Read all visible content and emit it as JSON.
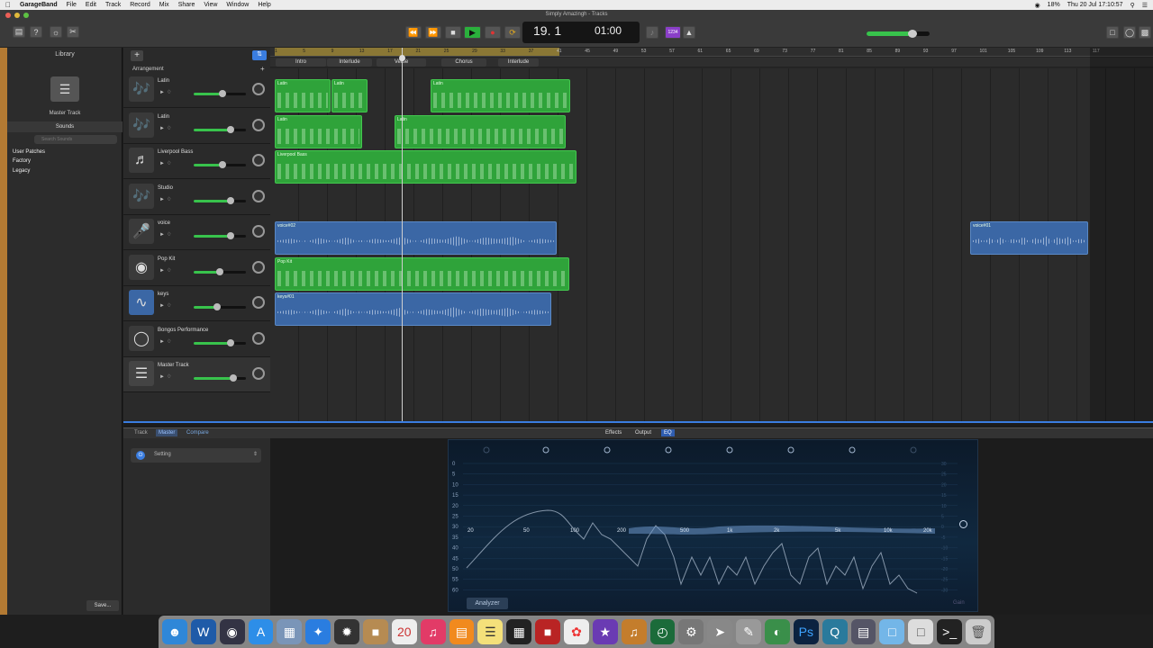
{
  "menubar": {
    "app": "GarageBand",
    "items": [
      "File",
      "Edit",
      "Track",
      "Record",
      "Mix",
      "Share",
      "View",
      "Window",
      "Help"
    ],
    "battery": "18%",
    "clock": "Thu 20 Jul  17:10:57"
  },
  "window": {
    "title": "Simply Amazingh - Tracks"
  },
  "lcd": {
    "bar_beat": "19. 1",
    "time": "01:00",
    "count_in": "1234"
  },
  "library": {
    "title": "Library",
    "preset_name": "Master Track",
    "sounds_label": "Sounds",
    "search_placeholder": "Search Sounds",
    "categories": [
      "User Patches",
      "Factory",
      "Legacy"
    ],
    "save_label": "Save..."
  },
  "tracks_header": {
    "arrangement_label": "Arrangement",
    "add": "+"
  },
  "ruler": {
    "bars": [
      "1",
      "5",
      "9",
      "13",
      "17",
      "21",
      "25",
      "29",
      "33",
      "37",
      "41",
      "45",
      "49",
      "53",
      "57",
      "61",
      "65",
      "69",
      "73",
      "77",
      "81",
      "85",
      "89",
      "93",
      "97",
      "101",
      "105",
      "109",
      "113",
      "117"
    ]
  },
  "arrangement_markers": [
    "Intro",
    "Interlude",
    "Verse",
    "Chorus",
    "Interlude"
  ],
  "tracks": [
    {
      "name": "Latin",
      "icon": "latin-percussion-icon",
      "volume": 0.55
    },
    {
      "name": "Latin",
      "icon": "latin-percussion-icon",
      "volume": 0.7
    },
    {
      "name": "Liverpool Bass",
      "icon": "bass-guitar-icon",
      "volume": 0.55
    },
    {
      "name": "Studio",
      "icon": "latin-percussion-icon",
      "volume": 0.7
    },
    {
      "name": "voice",
      "icon": "microphone-icon",
      "volume": 0.7
    },
    {
      "name": "Pop Kit",
      "icon": "drum-kit-icon",
      "volume": 0.5
    },
    {
      "name": "keys",
      "icon": "waveform-icon",
      "volume": 0.45
    },
    {
      "name": "Bongos Performance",
      "icon": "bongos-icon",
      "volume": 0.7
    },
    {
      "name": "Master Track",
      "icon": "master-track-icon",
      "volume": 0.75
    }
  ],
  "regions": [
    {
      "track": 0,
      "label": "Latin",
      "type": "midi"
    },
    {
      "track": 0,
      "label": "Latin",
      "type": "midi"
    },
    {
      "track": 0,
      "label": "Latin",
      "type": "midi"
    },
    {
      "track": 1,
      "label": "Latin",
      "type": "midi"
    },
    {
      "track": 1,
      "label": "Latin",
      "type": "midi"
    },
    {
      "track": 2,
      "label": "Liverpool Bass",
      "type": "midi"
    },
    {
      "track": 4,
      "label": "voice#02",
      "type": "audio"
    },
    {
      "track": 4,
      "label": "voice#01",
      "type": "audio"
    },
    {
      "track": 5,
      "label": "Pop Kit",
      "type": "midi"
    },
    {
      "track": 6,
      "label": "keys#01",
      "type": "audio"
    }
  ],
  "editor": {
    "tabs_left": [
      "Track",
      "Master",
      "Compare"
    ],
    "tabs_center": [
      "Effects",
      "Output",
      "EQ"
    ],
    "setting_label": "Setting",
    "analyzer_label": "Analyzer",
    "gain_label": "Gain",
    "db_left": [
      "0",
      "5",
      "10",
      "15",
      "20",
      "25",
      "30",
      "35",
      "40",
      "45",
      "50",
      "55",
      "60"
    ],
    "db_right": [
      "30",
      "25",
      "20",
      "15",
      "10",
      "5",
      "0",
      "-5",
      "-10",
      "-15",
      "-20",
      "-25",
      "-30"
    ],
    "freq_labels": [
      "20",
      "50",
      "100",
      "200",
      "500",
      "1k",
      "2k",
      "5k",
      "10k",
      "20k"
    ]
  },
  "colors": {
    "midi_region": "#2fa33a",
    "audio_region": "#3b67a5",
    "accent": "#3a7de0",
    "play": "#2ab03c",
    "record": "#e03434",
    "cycle": "#e0a820"
  }
}
